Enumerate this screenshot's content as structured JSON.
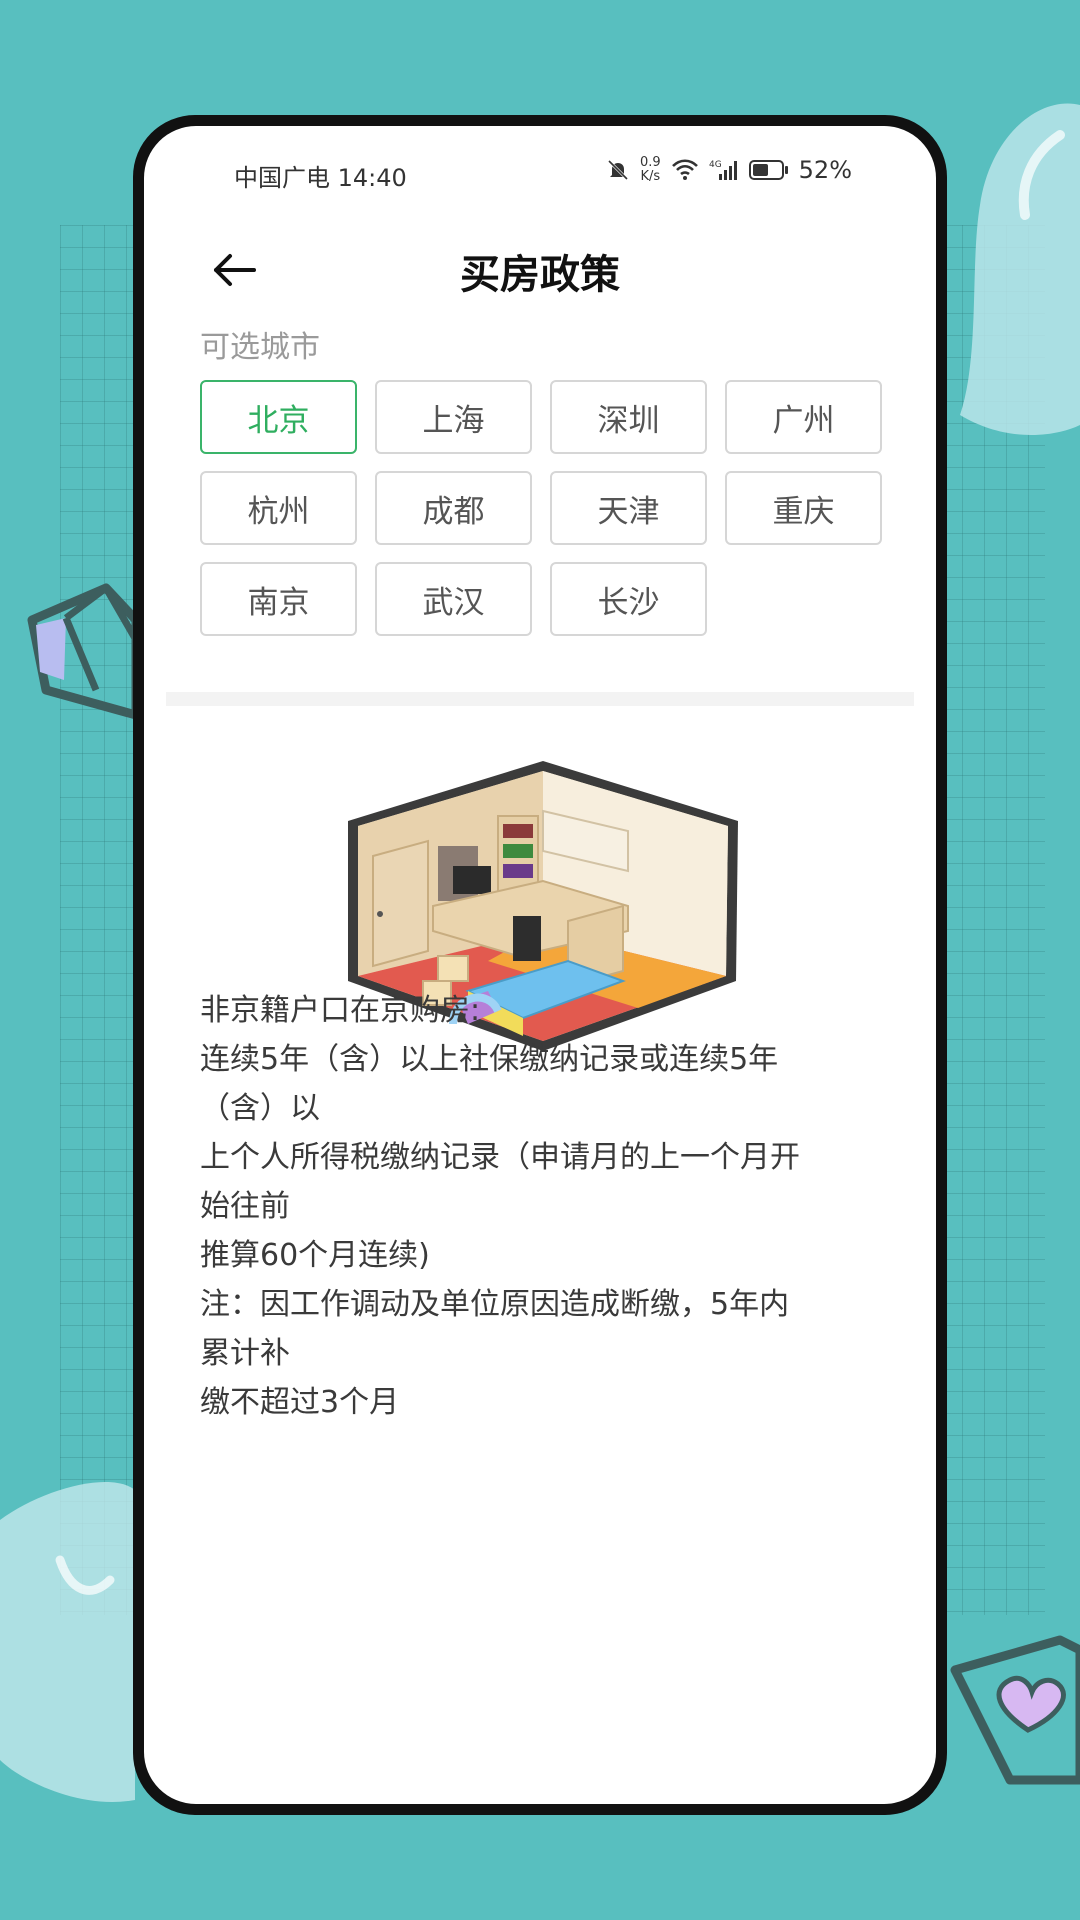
{
  "status_bar": {
    "carrier_time": "中国广电 14:40",
    "net_speed_value": "0.9",
    "net_speed_unit": "K/s",
    "network_type": "4G",
    "battery_percent": "52%"
  },
  "header": {
    "title": "买房政策",
    "back_icon": "arrow-left-icon"
  },
  "city_section": {
    "label": "可选城市",
    "selected": "北京",
    "cities": [
      "北京",
      "上海",
      "深圳",
      "广州",
      "杭州",
      "成都",
      "天津",
      "重庆",
      "南京",
      "武汉",
      "长沙"
    ]
  },
  "illustration": {
    "description_icon": "isometric-bedroom-icon"
  },
  "policy": {
    "lines": [
      "非京籍户口在京购房:",
      "连续5年（含）以上社保缴纳记录或连续5年",
      "（含）以",
      "上个人所得税缴纳记录（申请月的上一个月开",
      "始往前",
      "推算60个月连续)",
      "注：因工作调动及单位原因造成断缴，5年内",
      "累计补",
      "缴不超过3个月"
    ]
  },
  "colors": {
    "background": "#58bfbf",
    "accent_green": "#2fae5f",
    "phone_frame": "#111111"
  }
}
